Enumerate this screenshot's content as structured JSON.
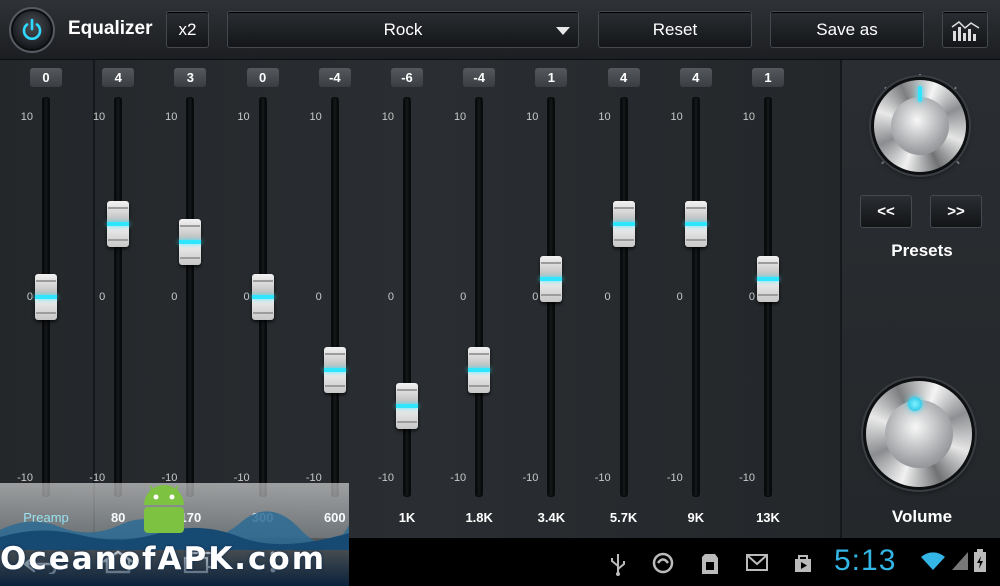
{
  "app": {
    "title": "Equalizer"
  },
  "toolbar": {
    "x2_label": "x2",
    "preset_selected": "Rock",
    "reset_label": "Reset",
    "save_as_label": "Save as"
  },
  "scale_labels": {
    "top": "10",
    "mid": "0",
    "bottom": "-10"
  },
  "bands": [
    {
      "label": "Preamp",
      "value": 0,
      "value_text": "0"
    },
    {
      "label": "80",
      "value": 4,
      "value_text": "4"
    },
    {
      "label": "170",
      "value": 3,
      "value_text": "3"
    },
    {
      "label": "300",
      "value": 0,
      "value_text": "0"
    },
    {
      "label": "600",
      "value": -4,
      "value_text": "-4"
    },
    {
      "label": "1K",
      "value": -6,
      "value_text": "-6"
    },
    {
      "label": "1.8K",
      "value": -4,
      "value_text": "-4"
    },
    {
      "label": "3.4K",
      "value": 1,
      "value_text": "1"
    },
    {
      "label": "5.7K",
      "value": 4,
      "value_text": "4"
    },
    {
      "label": "9K",
      "value": 4,
      "value_text": "4"
    },
    {
      "label": "13K",
      "value": 1,
      "value_text": "1"
    }
  ],
  "presets_panel": {
    "prev_label": "<<",
    "next_label": ">>",
    "presets_label": "Presets",
    "volume_label": "Volume"
  },
  "statusbar": {
    "clock": "5:13"
  },
  "watermark": {
    "text": "OceanofAPK.com"
  },
  "colors": {
    "accent": "#33b5e5",
    "slider_glow": "#2ee6ff",
    "preamp_label": "#4fd6f0"
  }
}
